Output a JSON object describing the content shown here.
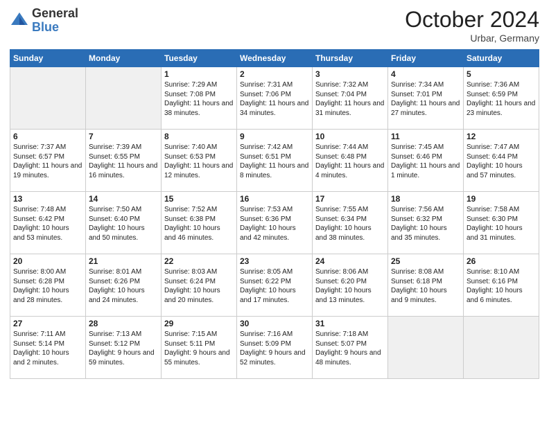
{
  "header": {
    "logo_general": "General",
    "logo_blue": "Blue",
    "month_title": "October 2024",
    "location": "Urbar, Germany"
  },
  "weekdays": [
    "Sunday",
    "Monday",
    "Tuesday",
    "Wednesday",
    "Thursday",
    "Friday",
    "Saturday"
  ],
  "weeks": [
    [
      {
        "day": "",
        "empty": true
      },
      {
        "day": "",
        "empty": true
      },
      {
        "day": "1",
        "sunrise": "Sunrise: 7:29 AM",
        "sunset": "Sunset: 7:08 PM",
        "daylight": "Daylight: 11 hours and 38 minutes."
      },
      {
        "day": "2",
        "sunrise": "Sunrise: 7:31 AM",
        "sunset": "Sunset: 7:06 PM",
        "daylight": "Daylight: 11 hours and 34 minutes."
      },
      {
        "day": "3",
        "sunrise": "Sunrise: 7:32 AM",
        "sunset": "Sunset: 7:04 PM",
        "daylight": "Daylight: 11 hours and 31 minutes."
      },
      {
        "day": "4",
        "sunrise": "Sunrise: 7:34 AM",
        "sunset": "Sunset: 7:01 PM",
        "daylight": "Daylight: 11 hours and 27 minutes."
      },
      {
        "day": "5",
        "sunrise": "Sunrise: 7:36 AM",
        "sunset": "Sunset: 6:59 PM",
        "daylight": "Daylight: 11 hours and 23 minutes."
      }
    ],
    [
      {
        "day": "6",
        "sunrise": "Sunrise: 7:37 AM",
        "sunset": "Sunset: 6:57 PM",
        "daylight": "Daylight: 11 hours and 19 minutes."
      },
      {
        "day": "7",
        "sunrise": "Sunrise: 7:39 AM",
        "sunset": "Sunset: 6:55 PM",
        "daylight": "Daylight: 11 hours and 16 minutes."
      },
      {
        "day": "8",
        "sunrise": "Sunrise: 7:40 AM",
        "sunset": "Sunset: 6:53 PM",
        "daylight": "Daylight: 11 hours and 12 minutes."
      },
      {
        "day": "9",
        "sunrise": "Sunrise: 7:42 AM",
        "sunset": "Sunset: 6:51 PM",
        "daylight": "Daylight: 11 hours and 8 minutes."
      },
      {
        "day": "10",
        "sunrise": "Sunrise: 7:44 AM",
        "sunset": "Sunset: 6:48 PM",
        "daylight": "Daylight: 11 hours and 4 minutes."
      },
      {
        "day": "11",
        "sunrise": "Sunrise: 7:45 AM",
        "sunset": "Sunset: 6:46 PM",
        "daylight": "Daylight: 11 hours and 1 minute."
      },
      {
        "day": "12",
        "sunrise": "Sunrise: 7:47 AM",
        "sunset": "Sunset: 6:44 PM",
        "daylight": "Daylight: 10 hours and 57 minutes."
      }
    ],
    [
      {
        "day": "13",
        "sunrise": "Sunrise: 7:48 AM",
        "sunset": "Sunset: 6:42 PM",
        "daylight": "Daylight: 10 hours and 53 minutes."
      },
      {
        "day": "14",
        "sunrise": "Sunrise: 7:50 AM",
        "sunset": "Sunset: 6:40 PM",
        "daylight": "Daylight: 10 hours and 50 minutes."
      },
      {
        "day": "15",
        "sunrise": "Sunrise: 7:52 AM",
        "sunset": "Sunset: 6:38 PM",
        "daylight": "Daylight: 10 hours and 46 minutes."
      },
      {
        "day": "16",
        "sunrise": "Sunrise: 7:53 AM",
        "sunset": "Sunset: 6:36 PM",
        "daylight": "Daylight: 10 hours and 42 minutes."
      },
      {
        "day": "17",
        "sunrise": "Sunrise: 7:55 AM",
        "sunset": "Sunset: 6:34 PM",
        "daylight": "Daylight: 10 hours and 38 minutes."
      },
      {
        "day": "18",
        "sunrise": "Sunrise: 7:56 AM",
        "sunset": "Sunset: 6:32 PM",
        "daylight": "Daylight: 10 hours and 35 minutes."
      },
      {
        "day": "19",
        "sunrise": "Sunrise: 7:58 AM",
        "sunset": "Sunset: 6:30 PM",
        "daylight": "Daylight: 10 hours and 31 minutes."
      }
    ],
    [
      {
        "day": "20",
        "sunrise": "Sunrise: 8:00 AM",
        "sunset": "Sunset: 6:28 PM",
        "daylight": "Daylight: 10 hours and 28 minutes."
      },
      {
        "day": "21",
        "sunrise": "Sunrise: 8:01 AM",
        "sunset": "Sunset: 6:26 PM",
        "daylight": "Daylight: 10 hours and 24 minutes."
      },
      {
        "day": "22",
        "sunrise": "Sunrise: 8:03 AM",
        "sunset": "Sunset: 6:24 PM",
        "daylight": "Daylight: 10 hours and 20 minutes."
      },
      {
        "day": "23",
        "sunrise": "Sunrise: 8:05 AM",
        "sunset": "Sunset: 6:22 PM",
        "daylight": "Daylight: 10 hours and 17 minutes."
      },
      {
        "day": "24",
        "sunrise": "Sunrise: 8:06 AM",
        "sunset": "Sunset: 6:20 PM",
        "daylight": "Daylight: 10 hours and 13 minutes."
      },
      {
        "day": "25",
        "sunrise": "Sunrise: 8:08 AM",
        "sunset": "Sunset: 6:18 PM",
        "daylight": "Daylight: 10 hours and 9 minutes."
      },
      {
        "day": "26",
        "sunrise": "Sunrise: 8:10 AM",
        "sunset": "Sunset: 6:16 PM",
        "daylight": "Daylight: 10 hours and 6 minutes."
      }
    ],
    [
      {
        "day": "27",
        "sunrise": "Sunrise: 7:11 AM",
        "sunset": "Sunset: 5:14 PM",
        "daylight": "Daylight: 10 hours and 2 minutes."
      },
      {
        "day": "28",
        "sunrise": "Sunrise: 7:13 AM",
        "sunset": "Sunset: 5:12 PM",
        "daylight": "Daylight: 9 hours and 59 minutes."
      },
      {
        "day": "29",
        "sunrise": "Sunrise: 7:15 AM",
        "sunset": "Sunset: 5:11 PM",
        "daylight": "Daylight: 9 hours and 55 minutes."
      },
      {
        "day": "30",
        "sunrise": "Sunrise: 7:16 AM",
        "sunset": "Sunset: 5:09 PM",
        "daylight": "Daylight: 9 hours and 52 minutes."
      },
      {
        "day": "31",
        "sunrise": "Sunrise: 7:18 AM",
        "sunset": "Sunset: 5:07 PM",
        "daylight": "Daylight: 9 hours and 48 minutes."
      },
      {
        "day": "",
        "empty": true
      },
      {
        "day": "",
        "empty": true
      }
    ]
  ]
}
